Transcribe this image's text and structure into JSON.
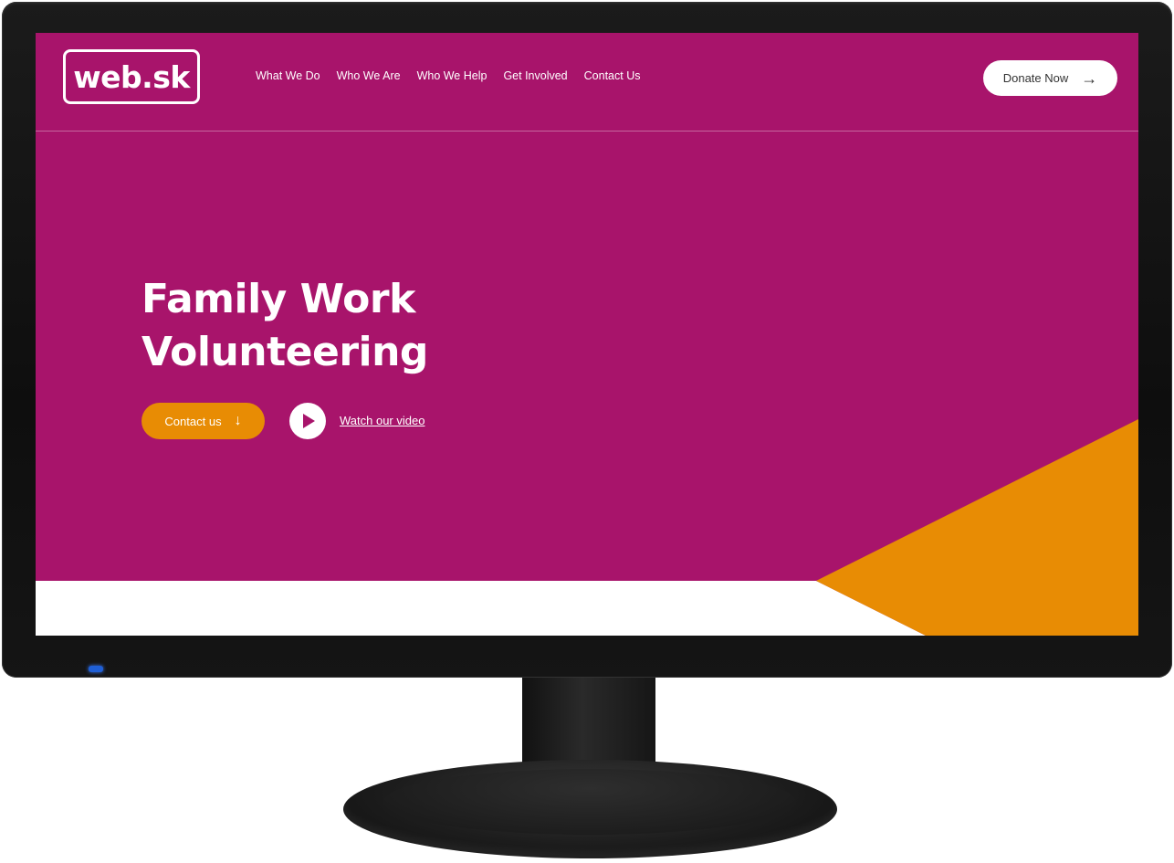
{
  "brand": {
    "logo_text": "web.sk"
  },
  "nav": {
    "items": [
      {
        "label": "What We Do"
      },
      {
        "label": "Who We Are"
      },
      {
        "label": "Who We Help"
      },
      {
        "label": "Get Involved"
      },
      {
        "label": "Contact Us"
      }
    ]
  },
  "header": {
    "donate_label": "Donate Now",
    "donate_icon": "arrow-right-icon"
  },
  "hero": {
    "title_line1": "Family Work",
    "title_line2": "Volunteering",
    "contact_label": "Contact us",
    "contact_icon": "arrow-down-icon",
    "video_label": "Watch our video",
    "video_icon": "play-icon"
  },
  "colors": {
    "primary": "#a8146b",
    "accent": "#e88c04",
    "text_on_primary": "#ffffff"
  }
}
